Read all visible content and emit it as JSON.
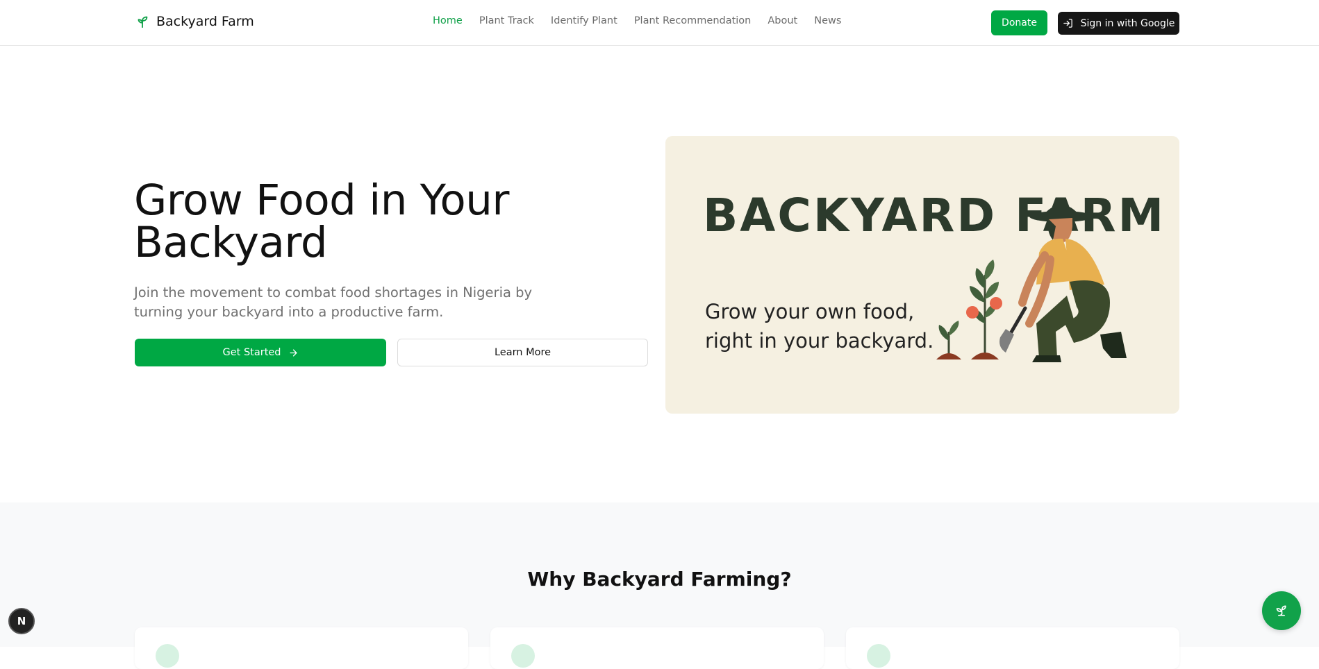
{
  "brand": {
    "name": "Backyard Farm",
    "icon": "sprout-icon",
    "accent": "#00a844"
  },
  "nav": {
    "items": [
      {
        "label": "Home",
        "active": true
      },
      {
        "label": "Plant Track",
        "active": false
      },
      {
        "label": "Identify Plant",
        "active": false
      },
      {
        "label": "Plant Recommendation",
        "active": false
      },
      {
        "label": "About",
        "active": false
      },
      {
        "label": "News",
        "active": false
      }
    ],
    "donate_label": "Donate",
    "signin_label": "Sign in with Google"
  },
  "hero": {
    "title": "Grow Food in Your Backyard",
    "subtitle": "Join the movement to combat food shortages in Nigeria by turning your backyard into a productive farm.",
    "primary_cta": "Get Started",
    "secondary_cta": "Learn More",
    "banner": {
      "title": "BACKYARD FARM",
      "tagline": "Grow your own food, right in your backyard.",
      "background": "#f5f0e1"
    }
  },
  "why": {
    "title": "Why Backyard Farming?"
  },
  "badges": {
    "dev_badge": "N"
  },
  "colors": {
    "primary": "#00a844",
    "dark_button": "#161616",
    "muted_text": "#707070"
  }
}
